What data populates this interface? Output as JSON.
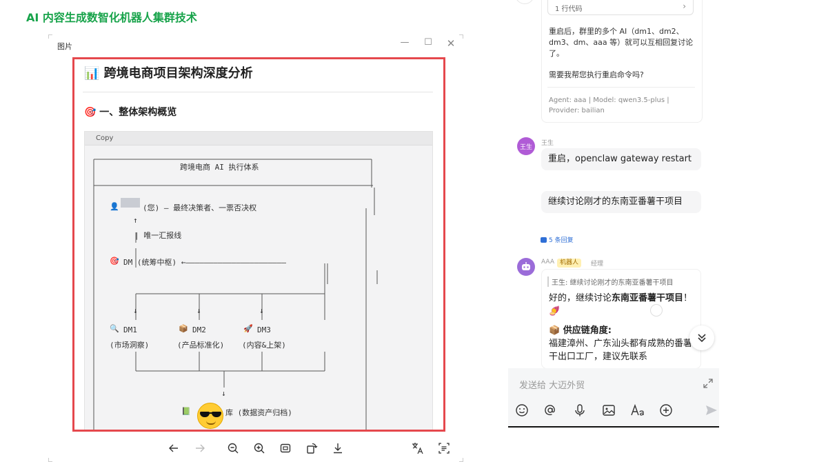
{
  "page_heading": "AI 内容生成数智化机器人集群技术",
  "viewer": {
    "title": "图片",
    "controls": {
      "minimize": "—",
      "maximize": "☐",
      "close": "✕"
    },
    "image": {
      "title": "📊 跨境电商项目架构深度分析",
      "section": "🎯 一、整体架构概览",
      "copy_label": "Copy",
      "diagram_title": "跨境电商 AI 执行体系",
      "owner_line": "(您) – 最终决策者、一票否决权",
      "owner_icon": "👤",
      "report_line": "| 唯一汇报线",
      "dm_hub": "DM (统筹中枢) ←——————————————————————",
      "dm_hub_icon": "🎯",
      "nodes": [
        {
          "icon": "🔍",
          "name": "DM1",
          "role": "(市场洞察)"
        },
        {
          "icon": "📦",
          "name": "DM2",
          "role": "(产品标准化)"
        },
        {
          "icon": "🚀",
          "name": "DM3",
          "role": "(内容&上架)"
        }
      ],
      "db_icon": "📗",
      "db_line": "库 (数据资产归档)"
    },
    "toolbar": [
      "arrow-left-icon",
      "arrow-right-icon",
      "zoom-out-icon",
      "zoom-in-icon",
      "fit-icon",
      "rotate-icon",
      "download-icon",
      "translate-icon",
      "ocr-icon"
    ]
  },
  "chat": {
    "prev_message": {
      "code_chip": "1 行代码",
      "para1": "重启后，群里的多个 AI（dm1、dm2、dm3、dm、aaa 等）就可以互相回复讨论了。",
      "para2": "需要我帮您执行重启命令吗?",
      "meta": "Agent: aaa | Model: qwen3.5-plus | Provider: bailian"
    },
    "wang": {
      "avatar": "王生",
      "name": "王生",
      "msg1": "重启，openclaw gateway restart",
      "msg2": "继续讨论刚才的东南亚番薯干项目",
      "replies": "5 条回复"
    },
    "bot": {
      "name": "AAA",
      "tag": "机器人",
      "role": "经理",
      "quote": "王生: 继续讨论刚才的东南亚番薯干项目",
      "line1_pre": "好的，继续讨论",
      "line1_bold": "东南亚番薯干项目",
      "line1_post": "！🍠",
      "heading": "📦 供应链角度:",
      "body": "福建漳州、广东汕头都有成熟的番薯干出口工厂，建议先联系"
    },
    "composer": {
      "placeholder": "发送给 大迈外贸",
      "tools": [
        "emoji-icon",
        "mention-icon",
        "mic-icon",
        "image-icon",
        "font-icon",
        "plus-icon",
        "send-icon"
      ]
    }
  }
}
